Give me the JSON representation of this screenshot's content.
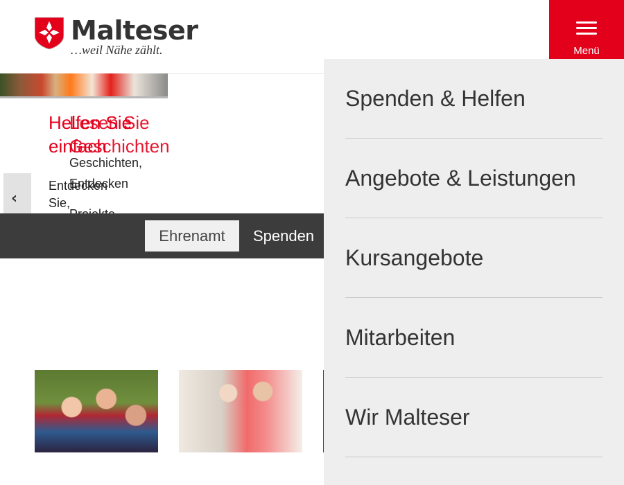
{
  "header": {
    "brand": "Malteser",
    "tagline": "…weil Nähe zählt.",
    "menu_label": "Menü"
  },
  "carousel": {
    "slide_a_title_1": "Helfen Sie",
    "slide_a_title_2": "einfach",
    "slide_a_text_1": "Entdecken",
    "slide_a_text_2": "Sie,",
    "slide_b_title_1": "Lesen Sie",
    "slide_b_title_2": "Geschichten",
    "slide_b_text_1": "Geschichten,",
    "slide_b_text_2": "Entdecken",
    "slide_b_text_3": "Projekte"
  },
  "actions": {
    "ehrenamt": "Ehrenamt",
    "spenden": "Spenden"
  },
  "side_menu": {
    "items": [
      "Spenden & Helfen",
      "Angebote & Leistungen",
      "Kursangebote",
      "Mitarbeiten",
      "Wir Malteser"
    ]
  },
  "colors": {
    "brand_red": "#e3001b",
    "dark_bar": "#3c3c3c",
    "menu_bg": "#eeeeee"
  }
}
